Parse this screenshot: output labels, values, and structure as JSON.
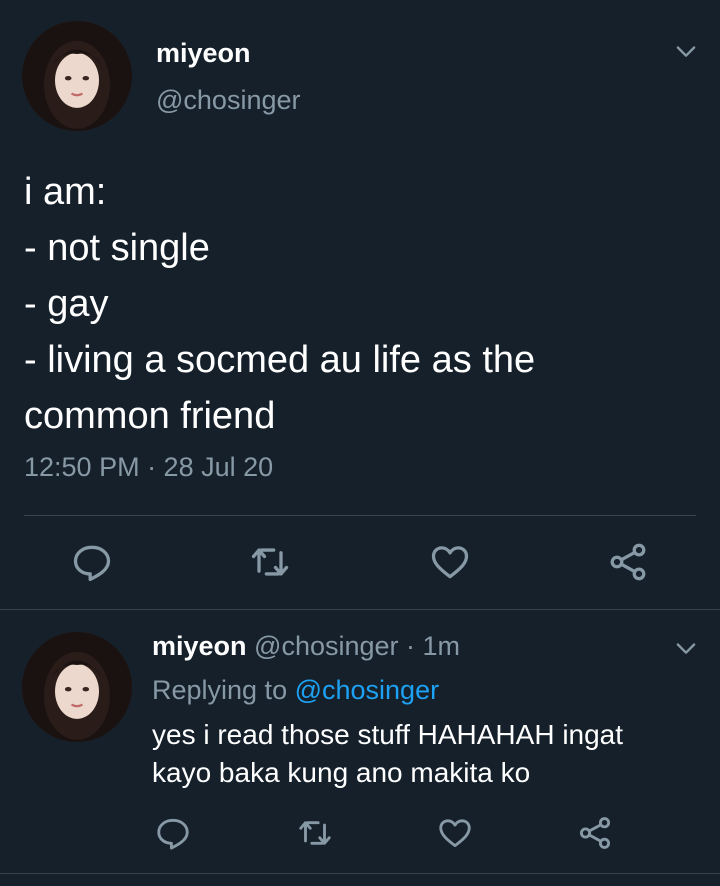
{
  "main_tweet": {
    "display_name": "miyeon",
    "handle": "@chosinger",
    "lines": [
      "i am:",
      "- not single",
      "- gay",
      "- living a socmed au life as the",
      "common friend"
    ],
    "timestamp": "12:50 PM · 28 Jul 20",
    "actions": [
      "reply-icon",
      "retweet-icon",
      "like-icon",
      "share-icon"
    ]
  },
  "reply_tweet": {
    "display_name": "miyeon",
    "meta": " @chosinger · 1m",
    "replying_prefix": "Replying to ",
    "replying_handle": "@chosinger",
    "lines": [
      "yes i read those stuff HAHAHAH ingat",
      "kayo baka kung ano makita ko"
    ],
    "actions": [
      "reply-icon",
      "retweet-icon",
      "like-icon",
      "share-icon"
    ]
  },
  "colors": {
    "background": "#15202b",
    "primary_text": "#ffffff",
    "secondary_text": "#8899a6",
    "accent": "#1da1f2",
    "divider": "#38444d"
  }
}
